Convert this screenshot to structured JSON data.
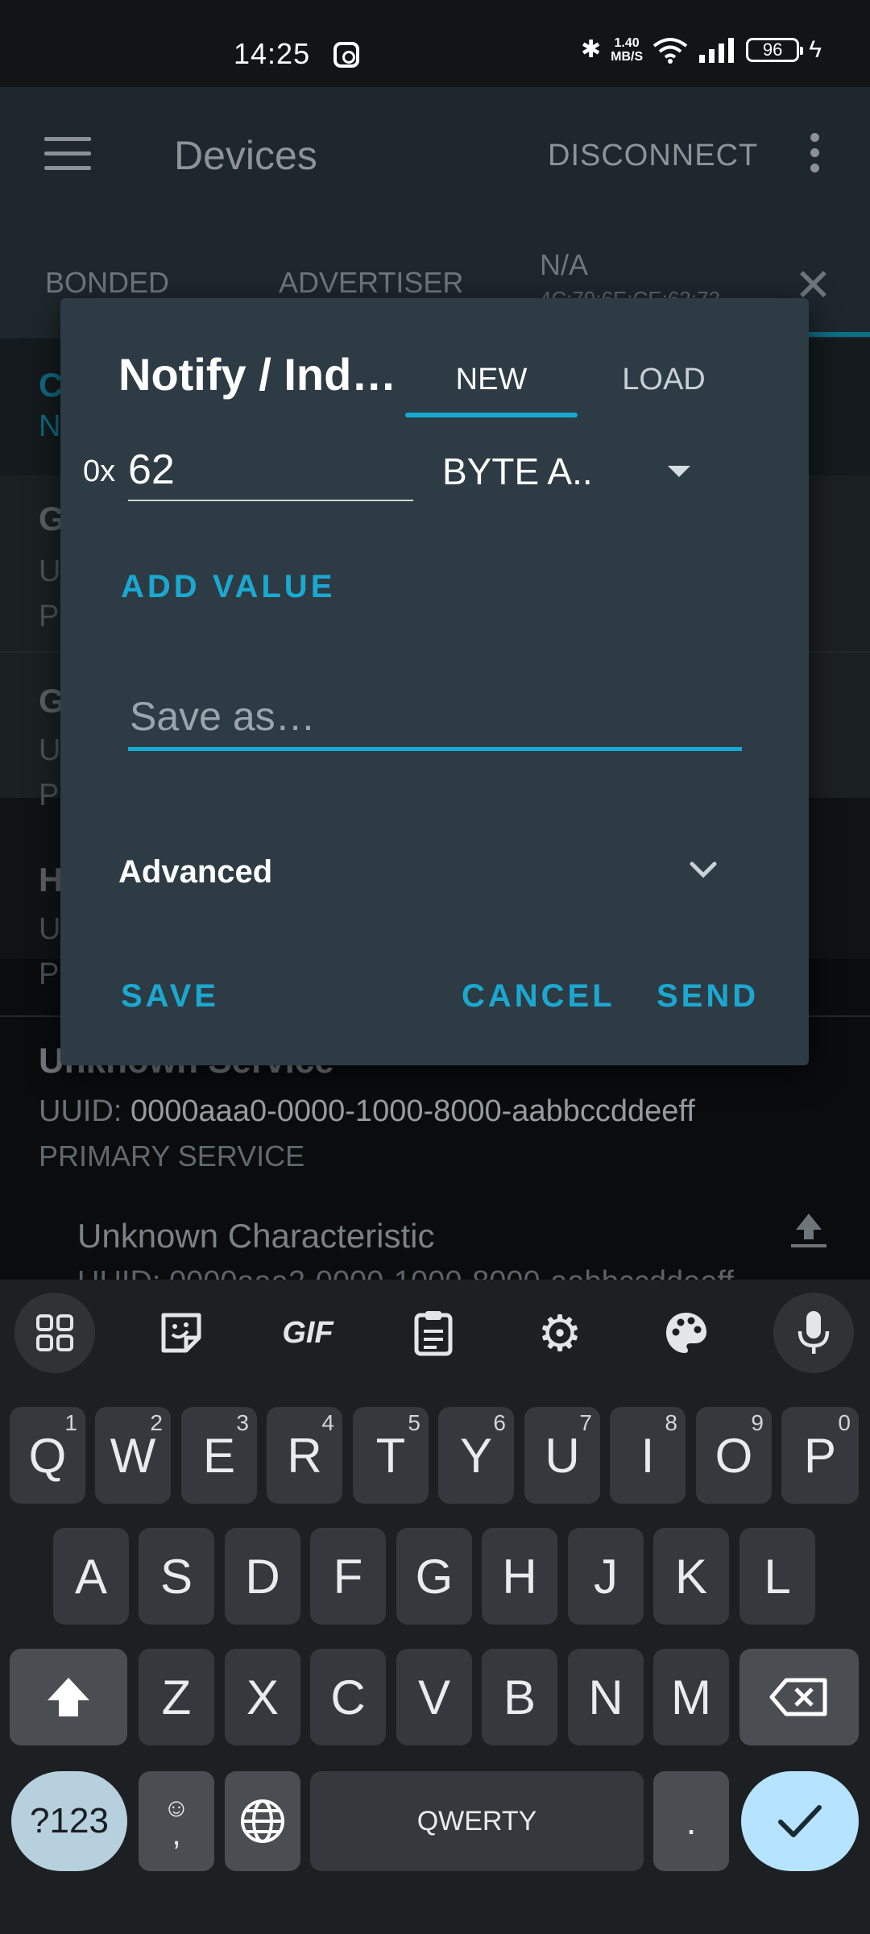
{
  "status_bar": {
    "time": "14:25",
    "speed_value": "1.40",
    "speed_unit": "MB/S",
    "battery": "96"
  },
  "app_bar": {
    "title": "Devices",
    "disconnect_label": "DISCONNECT"
  },
  "tabs": {
    "bonded": "BONDED",
    "advertiser": "ADVERTISER",
    "device_name": "N/A",
    "device_mac": "4C:79:6E:CE:63:73"
  },
  "background": {
    "row_letters": [
      "C",
      "N",
      "G",
      "U",
      "P",
      "G",
      "U",
      "P",
      "H",
      "U",
      "P"
    ],
    "service_title": "Unknown Service",
    "service_uuid_label": "UUID:",
    "service_uuid_value": "0000aaa0-0000-1000-8000-aabbccddeeff",
    "service_type": "PRIMARY SERVICE",
    "characteristic_title": "Unknown Characteristic",
    "characteristic_uuid": "UUID: 0000aaa2-0000-1000-8000-aabbccddeeff"
  },
  "dialog": {
    "title": "Notify / Ind…",
    "tab_new": "NEW",
    "tab_load": "LOAD",
    "hex_prefix": "0x",
    "value": "62",
    "format": "BYTE A..",
    "add_value": "ADD VALUE",
    "save_as_placeholder": "Save as…",
    "advanced": "Advanced",
    "save": "SAVE",
    "cancel": "CANCEL",
    "send": "SEND"
  },
  "keyboard": {
    "toolbar_icons": [
      "apps-grid-icon",
      "sticker-icon",
      "gif-icon",
      "clipboard-icon",
      "settings-icon",
      "palette-icon",
      "mic-icon"
    ],
    "gif_label": "GIF",
    "row1": [
      {
        "k": "Q",
        "n": "1"
      },
      {
        "k": "W",
        "n": "2"
      },
      {
        "k": "E",
        "n": "3"
      },
      {
        "k": "R",
        "n": "4"
      },
      {
        "k": "T",
        "n": "5"
      },
      {
        "k": "Y",
        "n": "6"
      },
      {
        "k": "U",
        "n": "7"
      },
      {
        "k": "I",
        "n": "8"
      },
      {
        "k": "O",
        "n": "9"
      },
      {
        "k": "P",
        "n": "0"
      }
    ],
    "row2": [
      "A",
      "S",
      "D",
      "F",
      "G",
      "H",
      "J",
      "K",
      "L"
    ],
    "row3": [
      "Z",
      "X",
      "C",
      "V",
      "B",
      "N",
      "M"
    ],
    "num_key": "?123",
    "emoji_comma_key": ",",
    "space_label": "QWERTY",
    "period_key": "."
  }
}
